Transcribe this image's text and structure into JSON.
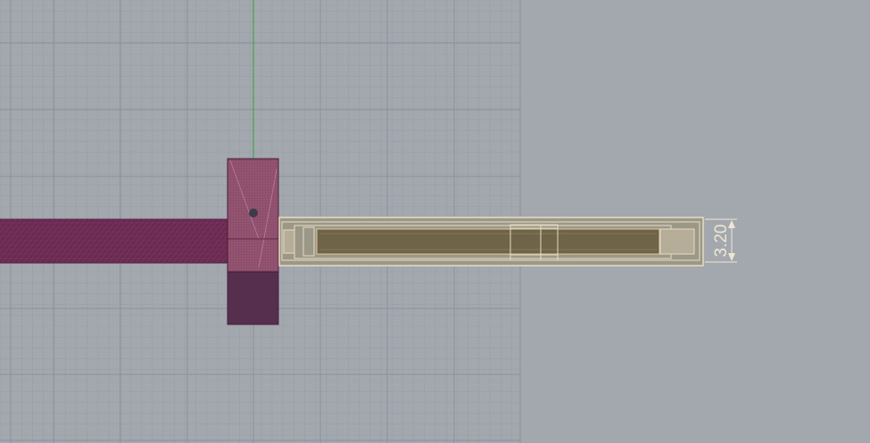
{
  "viewport": {
    "name": "cad-top-viewport",
    "colors": {
      "background": "#a3a8ae",
      "grid_minor": "#979ea6",
      "grid_major": "#8a929b",
      "axis_y": "#2fa53a",
      "rod": "#6b2a52",
      "block": "#7a3a60",
      "block_lower": "#4e2a4a",
      "housing_outline": "#e7dcc3",
      "housing_fill": "#9c9888",
      "slot_fill": "#6f6447",
      "dimension": "#efe6d2"
    }
  },
  "dimension": {
    "value": "3.20"
  }
}
